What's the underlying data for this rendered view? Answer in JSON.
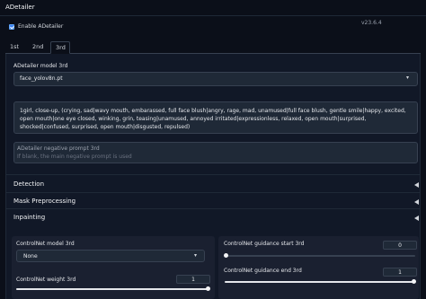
{
  "panel": {
    "title": "ADetailer"
  },
  "enable": {
    "label": "Enable ADetailer",
    "checked": true
  },
  "version": "v23.6.4",
  "tabs": [
    {
      "label": "1st",
      "active": false
    },
    {
      "label": "2nd",
      "active": false
    },
    {
      "label": "3rd",
      "active": true
    }
  ],
  "model": {
    "label": "ADetailer model 3rd",
    "value": "face_yolov8n.pt"
  },
  "prompt": {
    "value": "1girl, close-up, (crying, sad|wavy mouth, embarassed, full face blush|angry, rage, mad, unamused|full face blush, gentle smile|happy, excited, open mouth|one eye closed, winking, grin, teasing|unamused, annoyed irritated|expressionless, relaxed, open mouth|surprised, shocked|confused, surprised, open mouth|disgusted, repulsed)"
  },
  "negative_prompt": {
    "label": "ADetailer negative prompt 3rd",
    "placeholder": "If blank, the main negative prompt is used"
  },
  "sections": {
    "detection": "Detection",
    "mask": "Mask Preprocessing",
    "inpainting": "Inpainting"
  },
  "controlnet": {
    "model_label": "ControlNet model 3rd",
    "model_value": "None",
    "weight_label": "ControlNet weight 3rd",
    "weight_value": "1",
    "guidance_start_label": "ControlNet guidance start 3rd",
    "guidance_start_value": "0",
    "guidance_end_label": "ControlNet guidance end 3rd",
    "guidance_end_value": "1"
  },
  "colors": {
    "accent": "#3b82f6",
    "background": "#0b0f19",
    "panel": "#111827"
  }
}
